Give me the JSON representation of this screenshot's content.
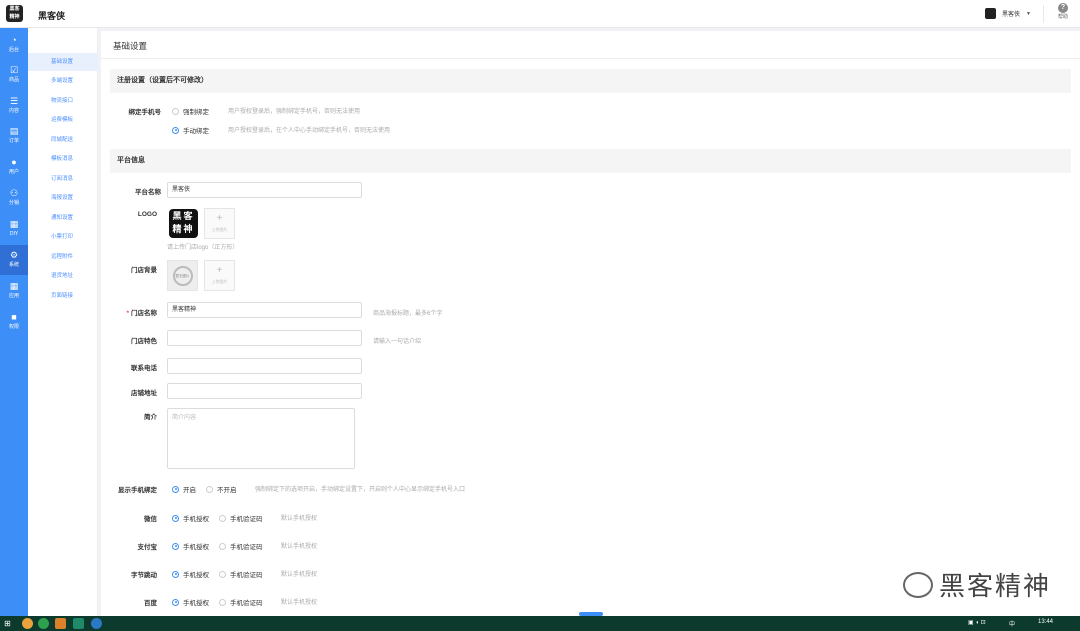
{
  "app": {
    "title": "黑客侠",
    "logo_text": "黑客 精神"
  },
  "user": {
    "name": "黑客侠"
  },
  "help": {
    "label": "帮助"
  },
  "nav": [
    {
      "label": "后台",
      "icon": "dashboard-icon",
      "glyph": "◔"
    },
    {
      "label": "商品",
      "icon": "goods-icon",
      "glyph": "☑"
    },
    {
      "label": "内容",
      "icon": "content-icon",
      "glyph": "☰"
    },
    {
      "label": "订单",
      "icon": "order-icon",
      "glyph": "▤"
    },
    {
      "label": "用户",
      "icon": "user-icon",
      "glyph": "●"
    },
    {
      "label": "分销",
      "icon": "distribution-icon",
      "glyph": "⚇"
    },
    {
      "label": "DIY",
      "icon": "diy-icon",
      "glyph": "▦"
    },
    {
      "label": "系统",
      "icon": "gear-icon",
      "glyph": "⚙"
    },
    {
      "label": "应用",
      "icon": "apps-icon",
      "glyph": "▦"
    },
    {
      "label": "权限",
      "icon": "lock-icon",
      "glyph": "🔒"
    }
  ],
  "subnav": [
    "基础设置",
    "多端设置",
    "物流接口",
    "运费模板",
    "同城配送",
    "模板消息",
    "订阅消息",
    "海报设置",
    "通知设置",
    "小票打印",
    "远程附件",
    "退货地址",
    "页面链接"
  ],
  "page": {
    "title": "基础设置"
  },
  "register": {
    "section": "注册设置（设置后不可修改）",
    "bind_label": "绑定手机号",
    "options": [
      {
        "label": "强制绑定",
        "hint": "用户授权登录后，强制绑定手机号，否则无法使用"
      },
      {
        "label": "手动绑定",
        "hint": "用户授权登录后，在个人中心手动绑定手机号，否则无法使用"
      }
    ]
  },
  "platform": {
    "section": "平台信息",
    "name_label": "平台名称",
    "name_value": "黑客侠",
    "logo_label": "LOGO",
    "logo_hint": "请上传门店logo（正方形）",
    "upload_text": "上传图片",
    "bg_label": "门店背景",
    "bg_placeholder": "暂无图片",
    "store_name_label": "门店名称",
    "store_name_value": "黑客精神",
    "store_name_hint": "商品海报标题，最多6个字",
    "feature_label": "门店特色",
    "feature_hint": "请输入一句话介绍",
    "phone_label": "联系电话",
    "address_label": "店铺地址",
    "intro_label": "简介",
    "intro_placeholder": "简介内容",
    "show_phone_label": "显示手机绑定",
    "show_phone_on": "开启",
    "show_phone_off": "不开启",
    "show_phone_hint": "强制绑定下的选项开启，手动绑定设置下，开启则个人中心显示绑定手机号入口",
    "auth_rows": [
      {
        "label": "微信",
        "opt1": "手机授权",
        "opt2": "手机验证码",
        "hint": "默认手机授权"
      },
      {
        "label": "支付宝",
        "opt1": "手机授权",
        "opt2": "手机验证码",
        "hint": "默认手机授权"
      },
      {
        "label": "字节跳动",
        "opt1": "手机授权",
        "opt2": "手机验证码",
        "hint": "默认手机授权"
      },
      {
        "label": "百度",
        "opt1": "手机授权",
        "opt2": "手机验证码",
        "hint": "默认手机授权"
      }
    ]
  },
  "watermark": {
    "text": "黑客精神"
  },
  "taskbar": {
    "time": "13:44",
    "ime": "中"
  },
  "colors": {
    "accent": "#3e8ef7",
    "taskbar": "#0c3a2c"
  }
}
